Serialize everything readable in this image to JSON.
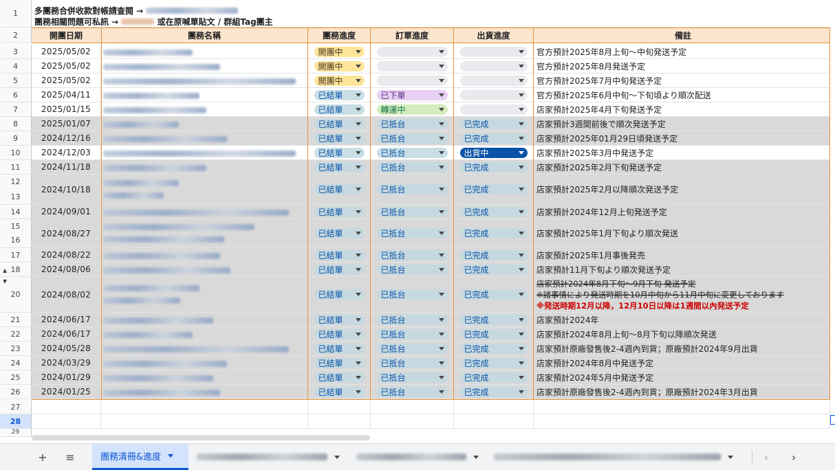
{
  "info": {
    "line1_prefix": "多團務合併收款對帳請查閱 →",
    "line2_prefix": "團務相關問題可私訊 →",
    "line2_suffix": "或在原喊單貼文 / 群組Tag團主"
  },
  "headers": {
    "date": "開團日期",
    "name": "團務名稱",
    "group_status": "團務進度",
    "order_status": "訂單進度",
    "ship_status": "出貨進度",
    "notes": "備註"
  },
  "row_numbers": [
    "1",
    "2",
    "3",
    "4",
    "5",
    "6",
    "7",
    "8",
    "9",
    "10",
    "11",
    "12",
    "13",
    "14",
    "15",
    "16",
    "17",
    "18",
    "20",
    "21",
    "22",
    "23",
    "24",
    "25",
    "26",
    "27",
    "28",
    "29"
  ],
  "rows": [
    {
      "num": "3",
      "date": "2025/05/02",
      "group": "開團中",
      "order": "",
      "ship": "",
      "note": "官方預計2025年8月上旬～中旬発送予定"
    },
    {
      "num": "4",
      "date": "2025/05/02",
      "group": "開團中",
      "order": "",
      "ship": "",
      "note": "官方預計2025年8月発送予定"
    },
    {
      "num": "5",
      "date": "2025/05/02",
      "group": "開團中",
      "order": "",
      "ship": "",
      "note": "官方預計2025年7月中旬発送予定"
    },
    {
      "num": "6",
      "date": "2025/04/11",
      "group": "已結單",
      "order": "已下單",
      "ship": "",
      "note": "官方預計2025年6月中旬～下旬頃より順次配送"
    },
    {
      "num": "7",
      "date": "2025/01/15",
      "group": "已結單",
      "order": "轉運中",
      "ship": "",
      "note": "店家預計2025年4月下旬発送予定"
    },
    {
      "num": "8",
      "date": "2025/01/07",
      "group": "已結單",
      "order": "已抵台",
      "ship": "已完成",
      "note": "店家預計3週間前後で順次発送予定"
    },
    {
      "num": "9",
      "date": "2024/12/16",
      "group": "已結單",
      "order": "已抵台",
      "ship": "已完成",
      "note": "店家預計2025年01月29日頃発送予定"
    },
    {
      "num": "10",
      "date": "2024/12/03",
      "group": "已結單",
      "order": "已抵台",
      "ship": "出貨中",
      "note": "店家預計2025年3月中発送予定"
    },
    {
      "num": "11",
      "date": "2024/11/18",
      "group": "已結單",
      "order": "已抵台",
      "ship": "已完成",
      "note": "店家預計2025年2月下旬発送予定"
    },
    {
      "num": "12-13",
      "date": "2024/10/18",
      "group": "已結單",
      "order": "已抵台",
      "ship": "已完成",
      "note": "店家預計2025年2月以降順次発送予定"
    },
    {
      "num": "14",
      "date": "2024/09/01",
      "group": "已結單",
      "order": "已抵台",
      "ship": "已完成",
      "note": "店家預計2024年12月上旬発送予定"
    },
    {
      "num": "15-16",
      "date": "2024/08/27",
      "group": "已結單",
      "order": "已抵台",
      "ship": "已完成",
      "note": "店家預計2025年1月下旬より順次発送"
    },
    {
      "num": "17",
      "date": "2024/08/22",
      "group": "已結單",
      "order": "已抵台",
      "ship": "已完成",
      "note": "店家預計2025年1月事後発売"
    },
    {
      "num": "18",
      "date": "2024/08/06",
      "group": "已結單",
      "order": "已抵台",
      "ship": "已完成",
      "note": "店家預計11月下旬より順次発送予定"
    },
    {
      "num": "20",
      "date": "2024/08/02",
      "group": "已結單",
      "order": "已抵台",
      "ship": "已完成",
      "note_lines": [
        "店家預計2024年8月下旬～9月下旬 発送予定",
        "※諸事情により発送時期を10月中旬から11月中旬に変更しております",
        "※発送時期12月以降，12月10日以降は1週間以內発送予定"
      ]
    },
    {
      "num": "21",
      "date": "2024/06/17",
      "group": "已結單",
      "order": "已抵台",
      "ship": "已完成",
      "note": "店家預計2024年"
    },
    {
      "num": "22",
      "date": "2024/06/17",
      "group": "已結單",
      "order": "已抵台",
      "ship": "已完成",
      "note": "店家預計2024年8月上旬～8月下旬以降順次発送"
    },
    {
      "num": "23",
      "date": "2024/05/28",
      "group": "已結單",
      "order": "已抵台",
      "ship": "已完成",
      "note": "店家預計原廠發售後2-4週內到貨；原廠預計2024年9月出貨"
    },
    {
      "num": "24",
      "date": "2024/03/29",
      "group": "已結單",
      "order": "已抵台",
      "ship": "已完成",
      "note": "店家預計2024年8月中発送予定"
    },
    {
      "num": "25",
      "date": "2024/01/29",
      "group": "已結單",
      "order": "已抵台",
      "ship": "已完成",
      "note": "店家預計2024年5月中発送予定"
    },
    {
      "num": "26",
      "date": "2024/01/25",
      "group": "已結單",
      "order": "已抵台",
      "ship": "已完成",
      "note": "店家預計原廠發售後2-4週內到貨；原廠預計2024年3月出貨"
    }
  ],
  "tabbar": {
    "add_icon": "plus-icon",
    "menu_icon": "hamburger-icon",
    "active_tab": "團務清冊&進度",
    "prev_icon": "chevron-left-icon",
    "next_icon": "chevron-right-icon"
  },
  "colors": {
    "header_bg": "#fce5cd",
    "header_border": "#e69138",
    "done_row_bg": "#d9d9d9",
    "chip_open": "#ffe599",
    "chip_done": "#c9dfe6",
    "chip_ordered": "#e6cff2",
    "chip_transit": "#d4edbc",
    "chip_shipping": "#0a53a8",
    "note_red": "#cc0000"
  }
}
